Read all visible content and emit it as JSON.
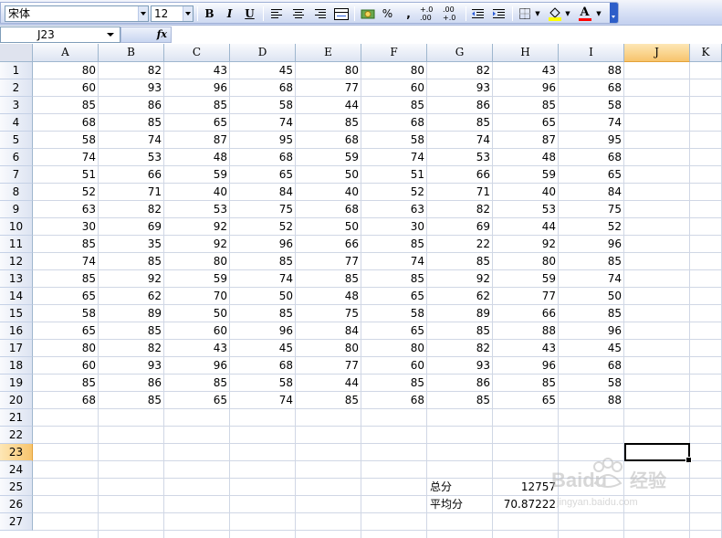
{
  "toolbar": {
    "font_name": "宋体",
    "font_size": "12",
    "bold_label": "B",
    "italic_label": "I",
    "underline_label": "U",
    "percent_label": "%",
    "comma_label": ",",
    "increase_decimal_label": "+.0 .00",
    "decrease_decimal_label": ".00 +.0",
    "font_color_label": "A",
    "fill_color": "#ffff00",
    "font_color": "#ff0000"
  },
  "formula_bar": {
    "name_box": "J23",
    "fx_label": "fx",
    "formula": ""
  },
  "sheet": {
    "active_cell": "J23",
    "active_column": "J",
    "active_row": "23",
    "columns": [
      "A",
      "B",
      "C",
      "D",
      "E",
      "F",
      "G",
      "H",
      "I",
      "J",
      "K"
    ],
    "rows": [
      "1",
      "2",
      "3",
      "4",
      "5",
      "6",
      "7",
      "8",
      "9",
      "10",
      "11",
      "12",
      "13",
      "14",
      "15",
      "16",
      "17",
      "18",
      "19",
      "20",
      "21",
      "22",
      "23",
      "24",
      "25",
      "26",
      "27"
    ],
    "data": [
      [
        80,
        82,
        43,
        45,
        80,
        80,
        82,
        43,
        88
      ],
      [
        60,
        93,
        96,
        68,
        77,
        60,
        93,
        96,
        68
      ],
      [
        85,
        86,
        85,
        58,
        44,
        85,
        86,
        85,
        58
      ],
      [
        68,
        85,
        65,
        74,
        85,
        68,
        85,
        65,
        74
      ],
      [
        58,
        74,
        87,
        95,
        68,
        58,
        74,
        87,
        95
      ],
      [
        74,
        53,
        48,
        68,
        59,
        74,
        53,
        48,
        68
      ],
      [
        51,
        66,
        59,
        65,
        50,
        51,
        66,
        59,
        65
      ],
      [
        52,
        71,
        40,
        84,
        40,
        52,
        71,
        40,
        84
      ],
      [
        63,
        82,
        53,
        75,
        68,
        63,
        82,
        53,
        75
      ],
      [
        30,
        69,
        92,
        52,
        50,
        30,
        69,
        44,
        52
      ],
      [
        85,
        35,
        92,
        96,
        66,
        85,
        22,
        92,
        96
      ],
      [
        74,
        85,
        80,
        85,
        77,
        74,
        85,
        80,
        85
      ],
      [
        85,
        92,
        59,
        74,
        85,
        85,
        92,
        59,
        74
      ],
      [
        65,
        62,
        70,
        50,
        48,
        65,
        62,
        77,
        50
      ],
      [
        58,
        89,
        50,
        85,
        75,
        58,
        89,
        66,
        85
      ],
      [
        65,
        85,
        60,
        96,
        84,
        65,
        85,
        88,
        96
      ],
      [
        80,
        82,
        43,
        45,
        80,
        80,
        82,
        43,
        45
      ],
      [
        60,
        93,
        96,
        68,
        77,
        60,
        93,
        96,
        68
      ],
      [
        85,
        86,
        85,
        58,
        44,
        85,
        86,
        85,
        58
      ],
      [
        68,
        85,
        65,
        74,
        85,
        68,
        85,
        65,
        88
      ]
    ],
    "summary": {
      "total_label": "总分",
      "total_value": "12757",
      "average_label": "平均分",
      "average_value": "70.87222"
    }
  },
  "watermark": {
    "brand": "Baidu",
    "brand_suffix": "经验",
    "url": "jingyan.baidu.com"
  }
}
